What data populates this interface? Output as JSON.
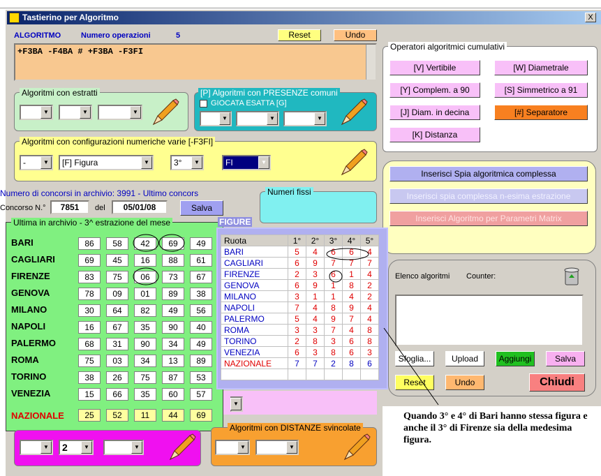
{
  "window": {
    "title": "Tastierino per Algoritmo",
    "close": "X"
  },
  "header": {
    "algoritmo_label": "ALGORITMO",
    "numero_label": "Numero operazioni",
    "numero_value": "5",
    "reset": "Reset",
    "undo": "Undo"
  },
  "formula": "+F3BA  -F4BA  #  +F3BA  -F3FI",
  "cumulativi": {
    "title": "Operatori algoritmici cumulativi",
    "buttons": [
      "[V] Vertibile",
      "[W] Diametrale",
      "[Y] Complem. a 90",
      "[S] Simmetrico  a 91",
      "[J] Diam. in decina",
      "[#] Separatore",
      "[K] Distanza"
    ]
  },
  "estratti": {
    "title": "Algoritmi con estratti"
  },
  "presenze": {
    "title": "[P] Algoritmi con PRESENZE comuni",
    "checkbox": "GIOCATA ESATTA  [G]"
  },
  "config": {
    "title": "Algoritmi con configurazioni numeriche varie  [-F3FI]",
    "sel1": "-",
    "sel2": "[F] Figura",
    "sel3": "3°",
    "sel4": "FI"
  },
  "spia": {
    "b1": "Inserisci Spia algoritmica complessa",
    "b2": "Inserisci spia complessa n-esima estrazione",
    "b3": "Inserisci Algoritmo per Parametri Matrix"
  },
  "archivio": {
    "info": "Numero di concorsi in archivio: 3991   -   Ultimo concors",
    "concorso_label": "Concorso N.°",
    "concorso": "7851",
    "del_label": "del",
    "data": "05/01/08",
    "salva": "Salva"
  },
  "fissi": {
    "title": "Numeri fissi"
  },
  "estrazione": {
    "title": "Ultima in archivio - 3^ estrazione del mese",
    "ruote": [
      {
        "name": "BARI",
        "n": [
          "86",
          "58",
          "42",
          "69",
          "49"
        ]
      },
      {
        "name": "CAGLIARI",
        "n": [
          "69",
          "45",
          "16",
          "88",
          "61"
        ]
      },
      {
        "name": "FIRENZE",
        "n": [
          "83",
          "75",
          "06",
          "73",
          "67"
        ]
      },
      {
        "name": "GENOVA",
        "n": [
          "78",
          "09",
          "01",
          "89",
          "38"
        ]
      },
      {
        "name": "MILANO",
        "n": [
          "30",
          "64",
          "82",
          "49",
          "56"
        ]
      },
      {
        "name": "NAPOLI",
        "n": [
          "16",
          "67",
          "35",
          "90",
          "40"
        ]
      },
      {
        "name": "PALERMO",
        "n": [
          "68",
          "31",
          "90",
          "34",
          "49"
        ]
      },
      {
        "name": "ROMA",
        "n": [
          "75",
          "03",
          "34",
          "13",
          "89"
        ]
      },
      {
        "name": "TORINO",
        "n": [
          "38",
          "26",
          "75",
          "87",
          "53"
        ]
      },
      {
        "name": "VENEZIA",
        "n": [
          "15",
          "66",
          "35",
          "60",
          "57"
        ]
      }
    ],
    "nazionale": {
      "name": "NAZIONALE",
      "n": [
        "25",
        "52",
        "11",
        "44",
        "69"
      ]
    }
  },
  "figure": {
    "title": "FIGURE",
    "headers": [
      "Ruota",
      "1°",
      "2°",
      "3°",
      "4°",
      "5°"
    ],
    "rows": [
      {
        "r": "BARI",
        "v": [
          "5",
          "4",
          "6",
          "6",
          "4"
        ]
      },
      {
        "r": "CAGLIARI",
        "v": [
          "6",
          "9",
          "7",
          "7",
          "7"
        ]
      },
      {
        "r": "FIRENZE",
        "v": [
          "2",
          "3",
          "6",
          "1",
          "4"
        ]
      },
      {
        "r": "GENOVA",
        "v": [
          "6",
          "9",
          "1",
          "8",
          "2"
        ]
      },
      {
        "r": "MILANO",
        "v": [
          "3",
          "1",
          "1",
          "4",
          "2"
        ]
      },
      {
        "r": "NAPOLI",
        "v": [
          "7",
          "4",
          "8",
          "9",
          "4"
        ]
      },
      {
        "r": "PALERMO",
        "v": [
          "5",
          "4",
          "9",
          "7",
          "4"
        ]
      },
      {
        "r": "ROMA",
        "v": [
          "3",
          "3",
          "7",
          "4",
          "8"
        ]
      },
      {
        "r": "TORINO",
        "v": [
          "2",
          "8",
          "3",
          "6",
          "8"
        ]
      },
      {
        "r": "VENEZIA",
        "v": [
          "6",
          "3",
          "8",
          "6",
          "3"
        ]
      },
      {
        "r": "NAZIONALE",
        "v": [
          "7",
          "7",
          "2",
          "8",
          "6"
        ]
      }
    ]
  },
  "elenco": {
    "label": "Elenco algoritmi",
    "counter": "Counter:",
    "sfoglia": "Sfoglia...",
    "upload": "Upload",
    "aggiungi": "Aggiungi",
    "salva": "Salva",
    "reset": "Reset",
    "undo": "Undo",
    "chiudi": "Chiudi"
  },
  "distanze": {
    "title": "Algoritmi con DISTANZE svincolate"
  },
  "bottom": {
    "sel2": "2"
  },
  "note": "Quando 3° e 4° di Bari hanno stessa figura e anche il 3° di Firenze sia della medesima figura."
}
